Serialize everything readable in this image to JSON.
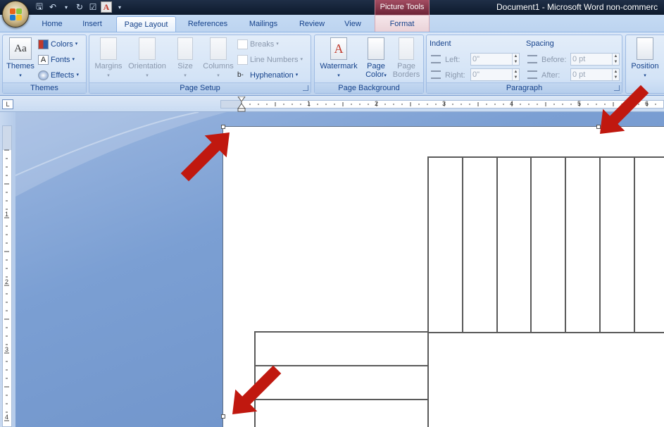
{
  "window": {
    "doc_title": "Document1 - Microsoft Word non-commerc",
    "contextual_tab_group": "Picture Tools"
  },
  "tabs": [
    {
      "label": "Home"
    },
    {
      "label": "Insert"
    },
    {
      "label": "Page Layout",
      "active": true
    },
    {
      "label": "References"
    },
    {
      "label": "Mailings"
    },
    {
      "label": "Review"
    },
    {
      "label": "View"
    },
    {
      "label": "Format",
      "contextual": true
    }
  ],
  "themes_group": {
    "label": "Themes",
    "themes_button": "Themes",
    "colors": "Colors",
    "fonts": "Fonts",
    "effects": "Effects"
  },
  "page_setup": {
    "label": "Page Setup",
    "margins": "Margins",
    "orientation": "Orientation",
    "size": "Size",
    "columns": "Columns",
    "breaks": "Breaks",
    "line_numbers": "Line Numbers",
    "hyphenation": "Hyphenation"
  },
  "page_background": {
    "label": "Page Background",
    "watermark": "Watermark",
    "page_color_line1": "Page",
    "page_color_line2": "Color",
    "page_borders_line1": "Page",
    "page_borders_line2": "Borders"
  },
  "paragraph": {
    "label": "Paragraph",
    "indent_title": "Indent",
    "left_label": "Left:",
    "left_value": "0\"",
    "right_label": "Right:",
    "right_value": "0\"",
    "spacing_title": "Spacing",
    "before_label": "Before:",
    "before_value": "0 pt",
    "after_label": "After:",
    "after_value": "0 pt"
  },
  "arrange": {
    "position": "Position"
  },
  "ruler": {
    "corner_symbol": "L",
    "h_numbers": [
      "1",
      "2",
      "3",
      "4",
      "5",
      "6"
    ],
    "v_numbers": [
      "1",
      "2",
      "3",
      "4"
    ]
  },
  "colors": {
    "ribbon": "#c5d9f1",
    "workspace": "#7b9fd3",
    "arrow": "#c0180f",
    "table_lines": "#5a5a5a"
  }
}
